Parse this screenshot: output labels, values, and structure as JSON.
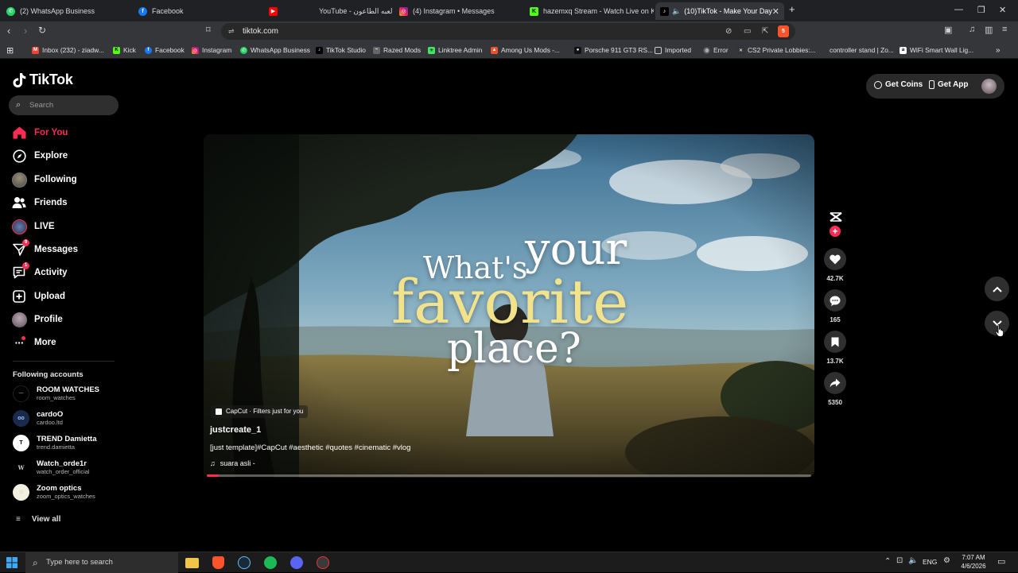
{
  "browser": {
    "tabs": [
      {
        "label": "(2) WhatsApp Business",
        "icon": "whatsapp-icon"
      },
      {
        "label": "Facebook",
        "icon": "facebook-icon"
      },
      {
        "label": "YouTube - لعبه الطاعون",
        "icon": "youtube-icon"
      },
      {
        "label": "(4) Instagram • Messages",
        "icon": "instagram-icon"
      },
      {
        "label": "hazemxq Stream - Watch Live on Kick",
        "icon": "kick-icon"
      },
      {
        "label": "(10)TikTok - Make Your Day",
        "icon": "tiktok-icon",
        "active": true
      }
    ],
    "url": "tiktok.com",
    "brave_badge": "5",
    "bookmarks": [
      {
        "label": "Inbox (232) - ziadw...",
        "icon": "gmail-icon"
      },
      {
        "label": "Kick",
        "icon": "kick-icon"
      },
      {
        "label": "Facebook",
        "icon": "facebook-icon"
      },
      {
        "label": "Instagram",
        "icon": "instagram-icon"
      },
      {
        "label": "WhatsApp Business",
        "icon": "whatsapp-icon"
      },
      {
        "label": "TikTok Studio",
        "icon": "tiktok-icon"
      },
      {
        "label": "Razed Mods",
        "icon": "razed-icon"
      },
      {
        "label": "Linktree Admin",
        "icon": "linktree-icon"
      },
      {
        "label": "Among Us Mods -...",
        "icon": "amongus-icon"
      },
      {
        "label": "Porsche 911 GT3 RS...",
        "icon": "porsche-icon"
      },
      {
        "label": "Imported",
        "icon": "folder-icon"
      },
      {
        "label": "Error",
        "icon": "globe-icon"
      },
      {
        "label": "CS2 Private Lobbies:...",
        "icon": "cs2-icon"
      },
      {
        "label": "controller stand | Zo...",
        "icon": "apple-icon"
      },
      {
        "label": "WiFi Smart Wall Lig...",
        "icon": "amazon-icon"
      }
    ]
  },
  "tiktok": {
    "logo": "TikTok",
    "search_placeholder": "Search",
    "nav": [
      {
        "label": "For You",
        "icon": "home-icon",
        "active": true
      },
      {
        "label": "Explore",
        "icon": "compass-icon"
      },
      {
        "label": "Following",
        "icon": "following-avatar-icon"
      },
      {
        "label": "Friends",
        "icon": "friends-icon"
      },
      {
        "label": "LIVE",
        "icon": "live-icon"
      },
      {
        "label": "Messages",
        "icon": "messages-icon",
        "badge": "9"
      },
      {
        "label": "Activity",
        "icon": "activity-icon",
        "badge": "1"
      },
      {
        "label": "Upload",
        "icon": "upload-icon"
      },
      {
        "label": "Profile",
        "icon": "profile-avatar-icon"
      },
      {
        "label": "More",
        "icon": "more-icon"
      }
    ],
    "following_header": "Following accounts",
    "following_accounts": [
      {
        "name": "ROOM WATCHES",
        "handle": "room_watches"
      },
      {
        "name": "cardoO",
        "handle": "cardoo.ltd"
      },
      {
        "name": "TREND Damietta",
        "handle": "trend.damietta"
      },
      {
        "name": "Watch_orde1r",
        "handle": "watch_order_official"
      },
      {
        "name": "Zoom optics",
        "handle": "zoom_optics_watches"
      }
    ],
    "view_all": "View all",
    "get_coins": "Get Coins",
    "get_app": "Get App",
    "video": {
      "overlay_line1a": "What's",
      "overlay_line1b": "your",
      "overlay_line2": "favorite",
      "overlay_line3": "place?",
      "capcut_tag": "CapCut · Filters just for you",
      "author": "justcreate_1",
      "caption": "[just template]#CapCut #aesthetic #quotes #cinematic #vlog",
      "sound": "suara asli -",
      "progress": 0.02
    },
    "actions": {
      "likes": "42.7K",
      "comments": "165",
      "saves": "13.7K",
      "shares": "5350"
    }
  },
  "taskbar": {
    "search_placeholder": "Type here to search",
    "language": "ENG",
    "time": "7:07 AM",
    "date": "4/6/2026"
  },
  "colors": {
    "tiktok_red": "#fe2c55",
    "overlay_yellow": "#f2e28c"
  }
}
